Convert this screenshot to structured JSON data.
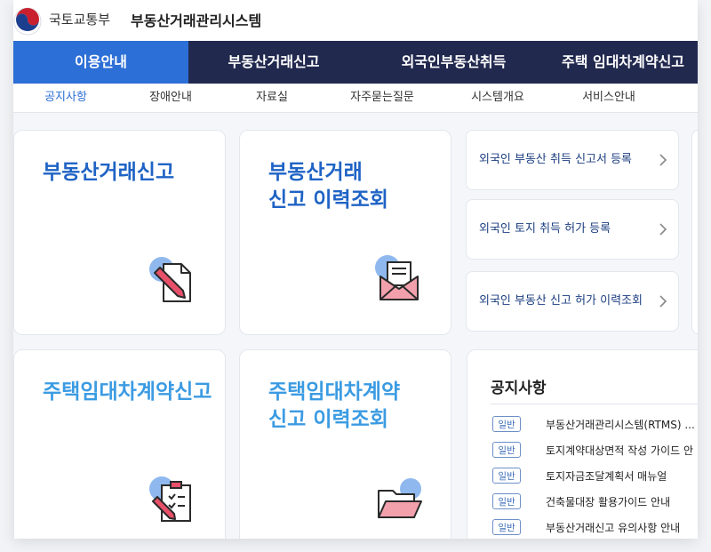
{
  "header": {
    "ministry": "국토교통부",
    "system_name": "부동산거래관리시스템"
  },
  "main_nav": [
    {
      "label": "이용안내",
      "active": true
    },
    {
      "label": "부동산거래신고",
      "active": false
    },
    {
      "label": "외국인부동산취득",
      "active": false
    },
    {
      "label": "주택 임대차계약신고",
      "active": false
    }
  ],
  "sub_nav": [
    {
      "label": "공지사항",
      "active": true
    },
    {
      "label": "장애안내",
      "active": false
    },
    {
      "label": "자료실",
      "active": false
    },
    {
      "label": "자주묻는질문",
      "active": false
    },
    {
      "label": "시스템개요",
      "active": false
    },
    {
      "label": "서비스안내",
      "active": false
    }
  ],
  "cards": [
    {
      "title": "부동산거래신고",
      "icon": "document-pen-icon"
    },
    {
      "title": "부동산거래\n신고 이력조회",
      "icon": "envelope-letter-icon"
    },
    {
      "title": "주택임대차계약신고",
      "icon": "clipboard-pen-icon"
    },
    {
      "title": "주택임대차계약\n신고 이력조회",
      "icon": "folder-open-icon"
    }
  ],
  "links": [
    {
      "label": "외국인 부동산 취득 신고서 등록"
    },
    {
      "label": "외국인 토지 취득 허가 등록"
    },
    {
      "label": "외국인 부동산 신고 허가 이력조회"
    }
  ],
  "notice": {
    "title": "공지사항",
    "items": [
      {
        "badge": "일반",
        "text": "부동산거래관리시스템(RTMS) ..."
      },
      {
        "badge": "일반",
        "text": "토지계약대상면적 작성 가이드 안"
      },
      {
        "badge": "일반",
        "text": "토지자금조달계획서 매뉴얼"
      },
      {
        "badge": "일반",
        "text": "건축물대장 활용가이드 안내"
      },
      {
        "badge": "일반",
        "text": "부동산거래신고 유의사항 안내"
      }
    ]
  },
  "colors": {
    "nav_bg": "#22294f",
    "nav_active": "#2c6fd6",
    "title_blue": "#1f63c5",
    "title_light_blue": "#3b9be2"
  }
}
